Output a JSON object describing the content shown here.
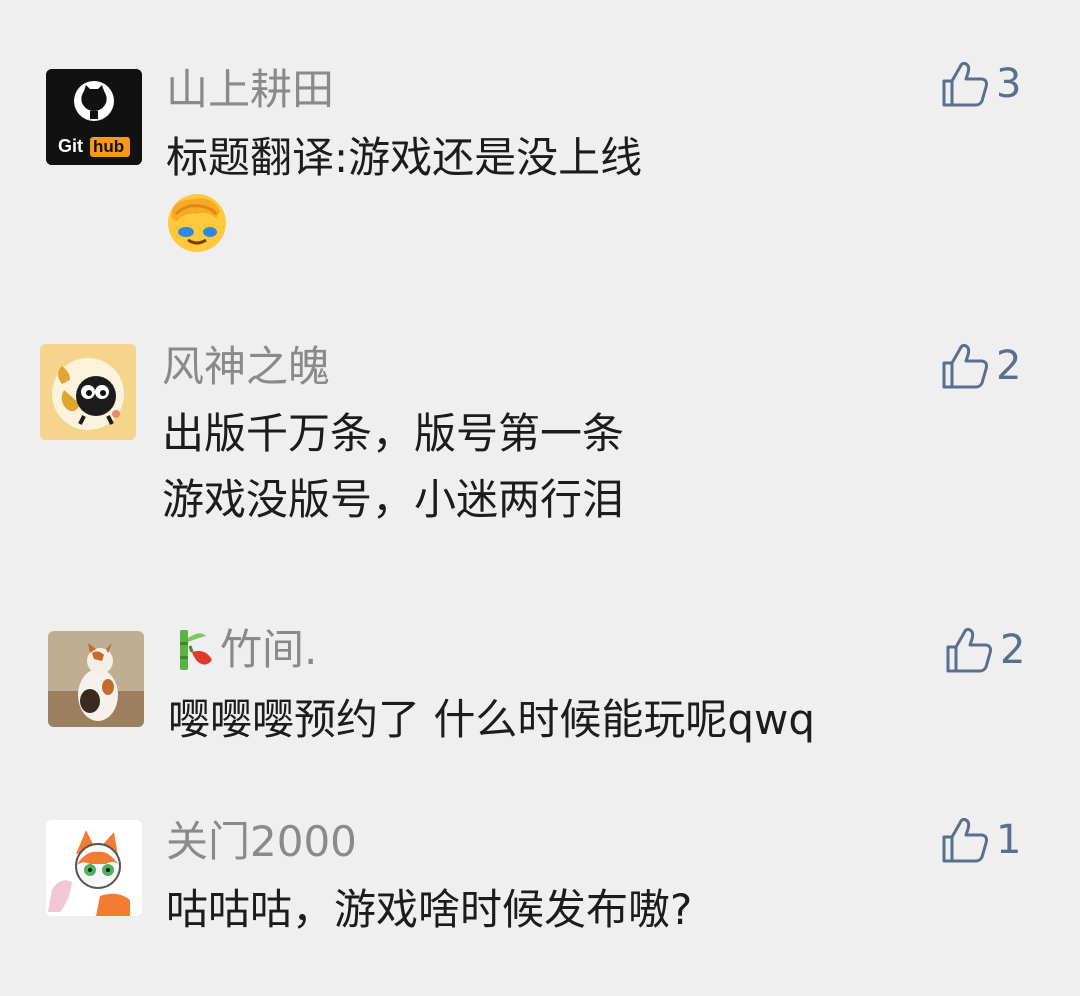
{
  "comments": [
    {
      "username": "山上耕田",
      "avatar": "github-logo-avatar",
      "avatar_text": "Git hub",
      "body_lines": [
        "标题翻译:游戏还是没上线"
      ],
      "emoji": "facepalm-crying-emoji",
      "likes": "3"
    },
    {
      "username": "风神之魄",
      "avatar": "cartoon-dragon-avatar",
      "body_lines": [
        "出版千万条，版号第一条",
        "游戏没版号，小迷两行泪"
      ],
      "likes": "2"
    },
    {
      "username": "竹间.",
      "name_emoji": "bamboo-chili-emoji",
      "avatar": "cat-photo-avatar",
      "body_lines": [
        "嘤嘤嘤预约了 什么时候能玩呢qwq"
      ],
      "likes": "2"
    },
    {
      "username": "关门2000",
      "avatar": "fox-drawing-avatar",
      "body_lines": [
        "咕咕咕，游戏啥时候发布嗷?"
      ],
      "likes": "1"
    }
  ],
  "colors": {
    "background": "#efefef",
    "username": "#8a8a8a",
    "body_text": "#1c1c1c",
    "like_accent": "#5a6f8f"
  },
  "icons": {
    "like": "thumbs-up-icon"
  }
}
